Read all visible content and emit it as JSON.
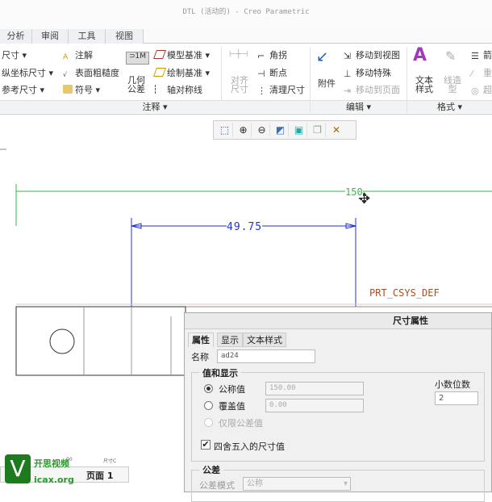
{
  "window": {
    "title": "DTL (活动的) - Creo Parametric"
  },
  "tabs": [
    "分析",
    "审阅",
    "工具",
    "视图"
  ],
  "ribbon": {
    "annotate": {
      "col1": [
        "尺寸 ▾",
        "纵坐标尺寸 ▾",
        "参考尺寸 ▾"
      ],
      "col2": [
        "注解",
        "表面粗糙度",
        "符号 ▾"
      ],
      "gtol": "几何\n公差",
      "gtol_a": "几何",
      "gtol_b": "公差",
      "col3": [
        "模型基准 ▾",
        "绘制基准 ▾",
        "轴对称线"
      ],
      "align_a": "对齐",
      "align_b": "尺寸",
      "col4": [
        "角拐",
        "断点",
        "清理尺寸"
      ],
      "label": "注释 ▾"
    },
    "edit": {
      "attach": "附件",
      "items": [
        "移动到视图",
        "移动特殊",
        "移动到页面"
      ],
      "label": "编辑 ▾"
    },
    "format": {
      "text_style_a": "文本",
      "text_style_b": "样式",
      "line_style_a": "线造",
      "line_style_b": "型",
      "items": [
        "箭",
        "重",
        "超"
      ],
      "label": "格式 ▾"
    }
  },
  "graphics_toolbar": [
    "refit-icon",
    "zoom-in-icon",
    "zoom-out-icon",
    "repaint-icon",
    "display-style-icon",
    "annotation-display-icon",
    "datum-display-icon"
  ],
  "drawing": {
    "dim_overall": "150",
    "dim_selected": "49.75",
    "csys_label": "PRT_CSYS_DEF",
    "colors": {
      "green": "#39b54a",
      "blue": "#2233cc",
      "brown": "#a0522d"
    }
  },
  "bottom": {
    "sheet_tab": "页面 1",
    "small_labels": [
      "00",
      "尺寸C"
    ],
    "watermark": "开思视频 icax.org",
    "watermark_logo": "V"
  },
  "dialog": {
    "title": "尺寸属性",
    "tabs": [
      "属性",
      "显示",
      "文本样式"
    ],
    "name_label": "名称",
    "name_value": "ad24",
    "value_group": "值和显示",
    "nominal_label": "公称值",
    "nominal_value": "150.00",
    "override_label": "覆盖值",
    "override_value": "0.00",
    "tol_only_label": "仅限公差值",
    "round_label": "四舍五入的尺寸值",
    "decimals_label": "小数位数",
    "decimals_value": "2",
    "tol_group": "公差",
    "tol_mode_label": "公差模式",
    "tol_mode_value": "公称"
  }
}
